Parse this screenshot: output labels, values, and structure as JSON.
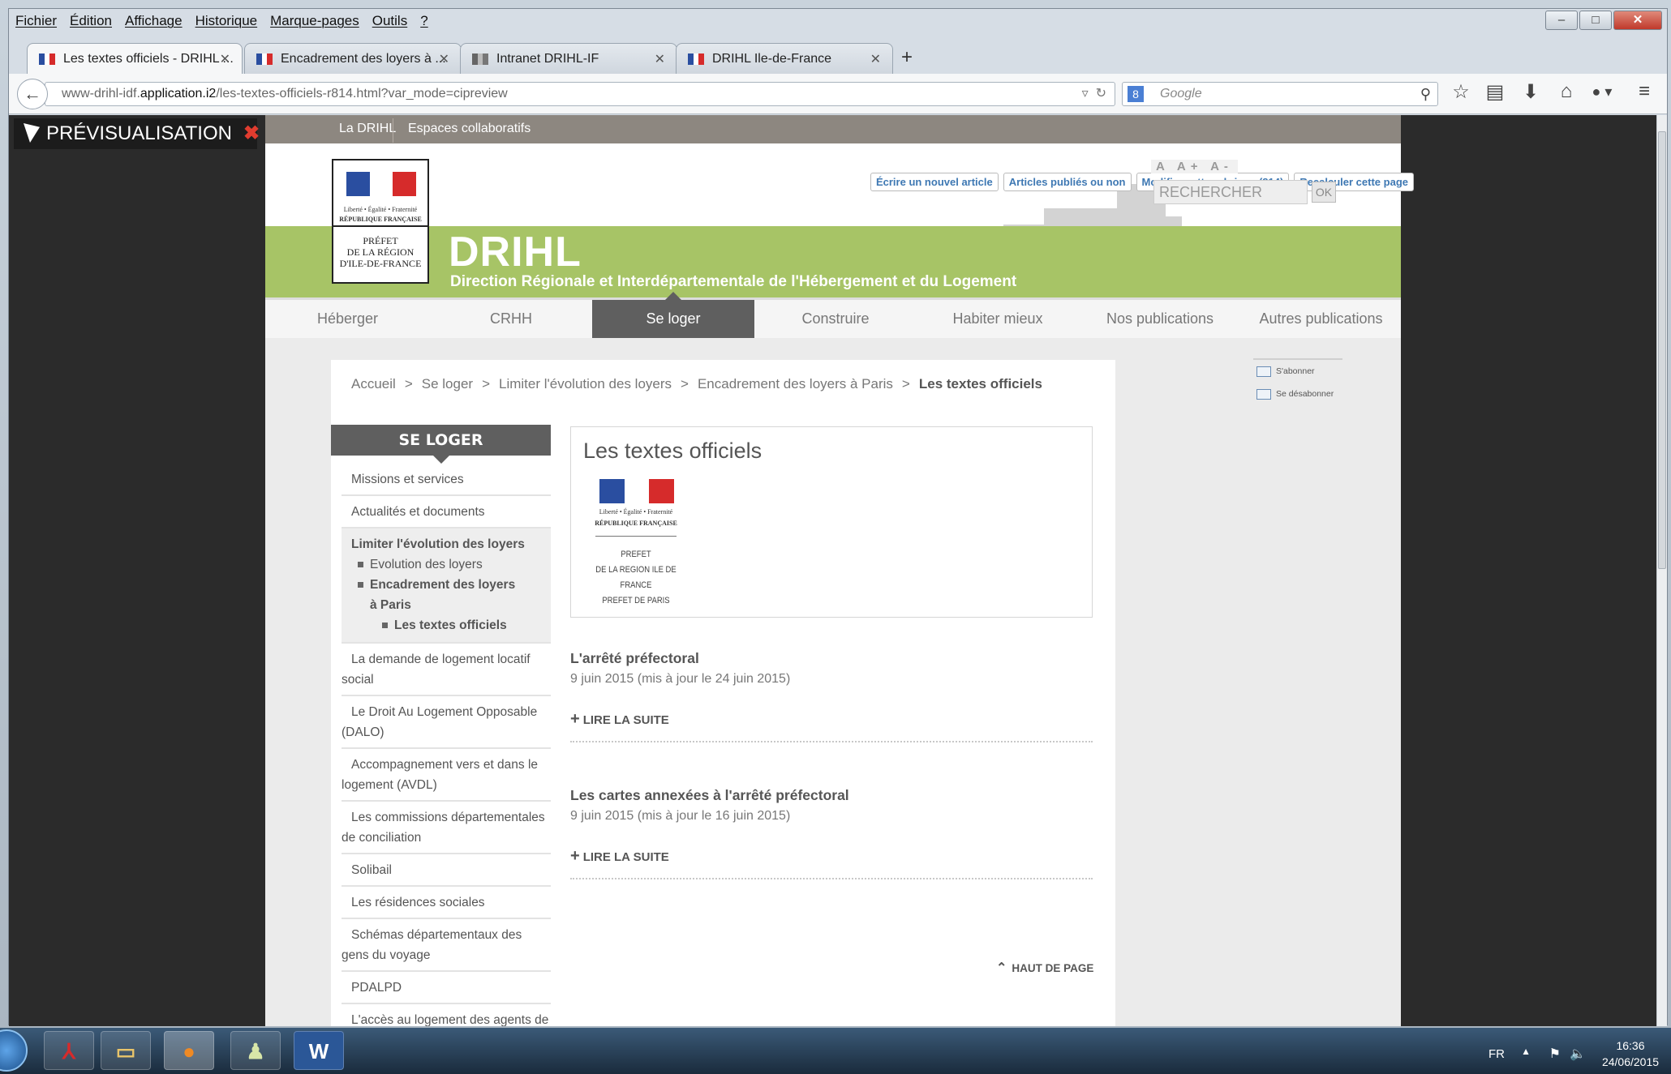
{
  "menubar": [
    "Fichier",
    "Édition",
    "Affichage",
    "Historique",
    "Marque-pages",
    "Outils",
    "?"
  ],
  "tabs": [
    {
      "label": "Les textes officiels - DRIHL ...",
      "active": true
    },
    {
      "label": "Encadrement des loyers à ..."
    },
    {
      "label": "Intranet DRIHL-IF"
    },
    {
      "label": "DRIHL Ile-de-France"
    }
  ],
  "address": {
    "prefix": "www-drihl-idf.",
    "domain": "application.i2",
    "path": "/les-textes-officiels-r814.html?var_mode=cipreview"
  },
  "search": {
    "engine_icon": "8",
    "placeholder": "Google"
  },
  "preview": {
    "label": "PRÉVISUALISATION",
    "close": "✖"
  },
  "site": {
    "toplinks": [
      "La DRIHL",
      "Espaces collaboratifs"
    ],
    "admin_buttons": [
      "Écrire un nouvel article",
      "Articles publiés ou non",
      "Modifier cette rubrique (814)",
      "Recalculer cette page"
    ],
    "font_controls": "A A+ A-",
    "search_placeholder": "RECHERCHER",
    "search_ok": "OK",
    "logo": {
      "motto": "Liberté • Égalité • Fraternité",
      "republique": "RÉPUBLIQUE FRANÇAISE",
      "prefet": [
        "PRÉFET",
        "DE LA RÉGION",
        "D'ILE-DE-FRANCE"
      ]
    },
    "brand": "DRIHL",
    "brand_sub": "Direction Régionale et Interdépartementale de l'Hébergement et du Logement",
    "nav": [
      "Héberger",
      "CRHH",
      "Se loger",
      "Construire",
      "Habiter mieux",
      "Nos publications",
      "Autres publications"
    ],
    "nav_active": "Se loger",
    "breadcrumb": [
      "Accueil",
      "Se loger",
      "Limiter l'évolution des loyers",
      "Encadrement des loyers à Paris"
    ],
    "breadcrumb_current": "Les textes officiels",
    "side_title": "SE LOGER",
    "side_items": {
      "missions": "Missions et services",
      "actualites": "Actualités et documents",
      "limiter": "Limiter l'évolution des loyers",
      "evolution": "Evolution des loyers",
      "encadrement": "Encadrement des loyers à Paris",
      "textes": "Les textes officiels",
      "demande": "La demande de logement locatif social",
      "dalo": "Le Droit Au Logement Opposable (DALO)",
      "avdl": "Accompagnement vers et dans le logement (AVDL)",
      "commissions": "Les commissions départementales de conciliation",
      "solibail": "Solibail",
      "residences": "Les résidences sociales",
      "schemas": "Schémas départementaux des gens du voyage",
      "pdalpd": "PDALPD",
      "acces": "L'accès au logement des agents de"
    },
    "page_title": "Les textes officiels",
    "article_logo": {
      "motto": "Liberté • Égalité • Fraternité",
      "republique": "RÉPUBLIQUE FRANÇAISE",
      "prefet": [
        "PREFET",
        "DE LA REGION ILE DE FRANCE",
        "PREFET DE PARIS"
      ]
    },
    "articles": [
      {
        "title": "L'arrêté préfectoral",
        "date": "9 juin 2015 (mis à jour le 24 juin 2015)",
        "more": "LIRE LA SUITE"
      },
      {
        "title": "Les cartes annexées à l'arrêté préfectoral",
        "date": "9 juin 2015 (mis à jour le 16 juin 2015)",
        "more": "LIRE LA SUITE"
      }
    ],
    "back_to_top": "HAUT DE PAGE",
    "subscribe": "S'abonner",
    "unsubscribe": "Se désabonner"
  },
  "taskbar": {
    "lang": "FR",
    "time": "16:36",
    "date": "24/06/2015"
  },
  "colors": {
    "green": "#a7c466",
    "purple": "#8b2b7a",
    "dark": "#2b2b2b",
    "nav_active": "#5f5f5f",
    "admin_link": "#3e78b3"
  }
}
